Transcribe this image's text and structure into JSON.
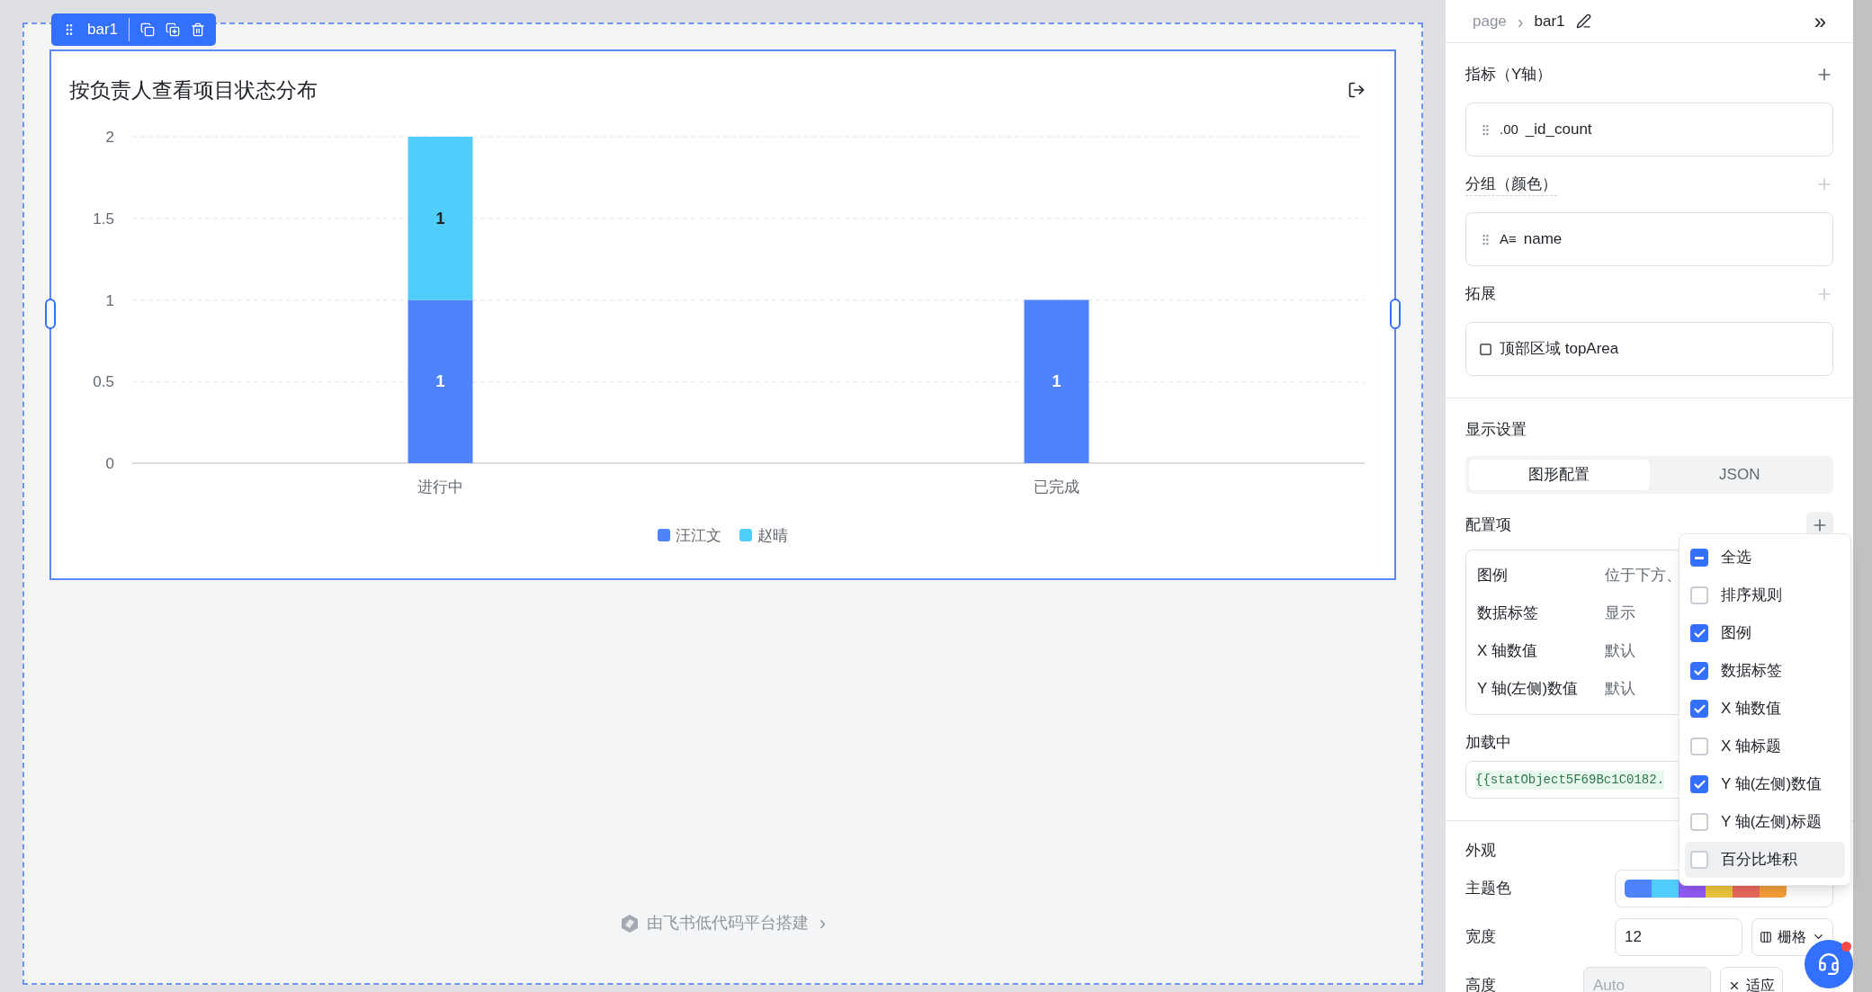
{
  "component_toolbar": {
    "name": "bar1"
  },
  "chart_card": {
    "title": "按负责人查看项目状态分布",
    "chart_data": {
      "type": "bar",
      "stacked": true,
      "grid": true,
      "legend": true,
      "categories": [
        "进行中",
        "已完成"
      ],
      "ylim": [
        0,
        2
      ],
      "yticks": [
        {
          "value": 0,
          "label": "0"
        },
        {
          "value": 0.5,
          "label": "0.5"
        },
        {
          "value": 1,
          "label": "1"
        },
        {
          "value": 1.5,
          "label": "1.5"
        },
        {
          "value": 2,
          "label": "2"
        }
      ],
      "data_labels": true,
      "series": [
        {
          "name": "汪江文",
          "color": "#4e83fd",
          "values": [
            1,
            1
          ]
        },
        {
          "name": "赵晴",
          "color": "#50cefb",
          "values": [
            1,
            null
          ]
        }
      ]
    }
  },
  "footer": {
    "text": "由飞书低代码平台搭建",
    "chevron": "›"
  },
  "panel": {
    "breadcrumb": [
      "page",
      "bar1"
    ],
    "breadcrumb_separator": "›",
    "collapse": "»",
    "fields": [
      {
        "label": "指标（Y轴）",
        "kind": "number",
        "value": "_id_count",
        "type_badge": ".00",
        "plus_muted": false
      },
      {
        "label": "分组（颜色）",
        "kind": "text",
        "value": "name",
        "type_badge": "A≡",
        "plus_muted": true
      },
      {
        "label": "拓展",
        "kind": "area",
        "value": "顶部区域 topArea",
        "plus_muted": true
      }
    ],
    "display_settings": {
      "title": "显示设置",
      "tabs": [
        {
          "label": "图形配置",
          "selected": true
        },
        {
          "label": "JSON",
          "selected": false
        }
      ]
    },
    "config": {
      "title": "配置项",
      "rows": [
        {
          "label": "图例",
          "value": "位于下方、"
        },
        {
          "label": "数据标签",
          "value": "显示"
        },
        {
          "label": "X 轴数值",
          "value": "默认"
        },
        {
          "label": "Y 轴(左侧)数值",
          "value": "默认"
        }
      ]
    },
    "loading": {
      "label": "加载中",
      "value": "{{statObject5F69Bc1C0182."
    },
    "appearance": {
      "title": "外观",
      "theme_label": "主题色",
      "theme_colors": [
        {
          "color": "#4e83fd"
        },
        {
          "color": "#50cefb"
        },
        {
          "color": "#935af6"
        },
        {
          "color": "#f0c73f"
        },
        {
          "color": "#ec6a5e"
        },
        {
          "color": "#f7a039"
        }
      ],
      "width_label": "宽度",
      "width_value": "12",
      "width_unit": "栅格",
      "height_label": "高度",
      "height_placeholder": "Auto",
      "height_unit": "适应"
    }
  },
  "dropdown": {
    "items": [
      {
        "label": "全选",
        "checked": true,
        "indeterminate": true,
        "selected": false
      },
      {
        "label": "排序规则",
        "checked": false,
        "indeterminate": false,
        "selected": false
      },
      {
        "label": "图例",
        "checked": true,
        "indeterminate": false,
        "selected": false
      },
      {
        "label": "数据标签",
        "checked": true,
        "indeterminate": false,
        "selected": false
      },
      {
        "label": "X 轴数值",
        "checked": true,
        "indeterminate": false,
        "selected": false
      },
      {
        "label": "X 轴标题",
        "checked": false,
        "indeterminate": false,
        "selected": false
      },
      {
        "label": "Y 轴(左侧)数值",
        "checked": true,
        "indeterminate": false,
        "selected": false
      },
      {
        "label": "Y 轴(左侧)标题",
        "checked": false,
        "indeterminate": false,
        "selected": false
      },
      {
        "label": "百分比堆积",
        "checked": false,
        "indeterminate": false,
        "selected": true
      }
    ]
  }
}
